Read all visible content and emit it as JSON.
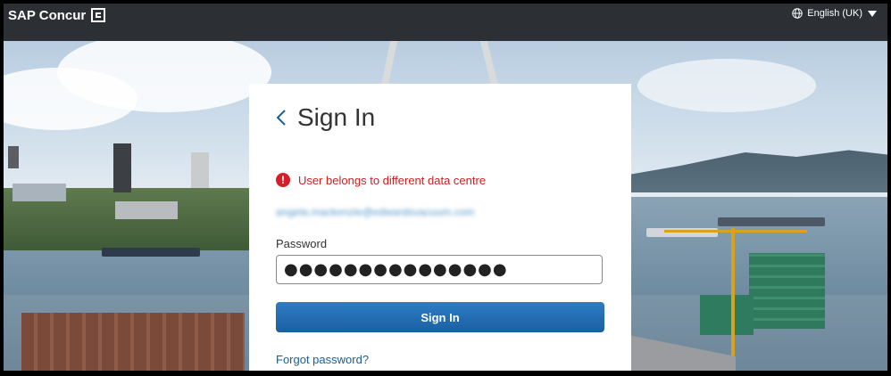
{
  "header": {
    "brand": "SAP Concur",
    "language": "English (UK)"
  },
  "signin": {
    "title": "Sign In",
    "error": "User belongs to different data centre",
    "email": "angela.mackenzie@edwardsvacuum.com",
    "password_label": "Password",
    "password_value": "●●●●●●●●●●●●●●●",
    "button": "Sign In",
    "forgot": "Forgot password?"
  },
  "colors": {
    "accent": "#1b5fa2",
    "error": "#cc1f1f",
    "header": "#2c3035"
  }
}
